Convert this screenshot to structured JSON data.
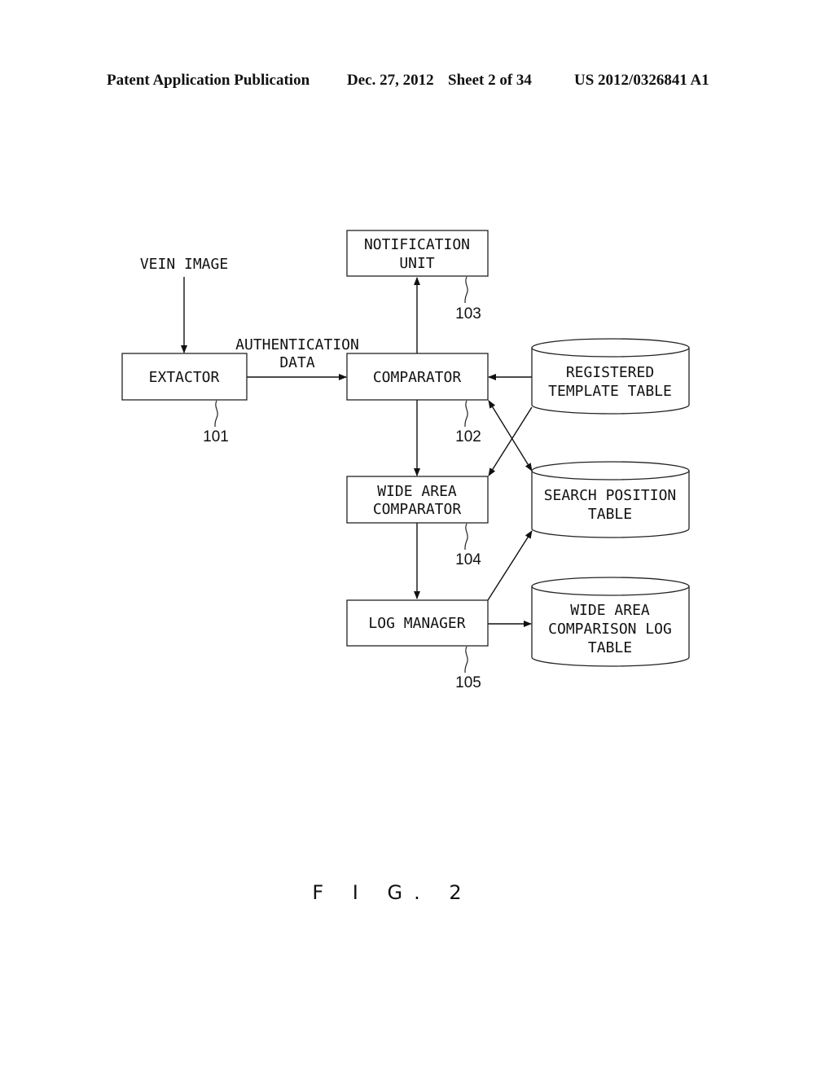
{
  "header": {
    "publication": "Patent Application Publication",
    "date": "Dec. 27, 2012",
    "sheet": "Sheet 2 of 34",
    "number": "US 2012/0326841 A1"
  },
  "diagram": {
    "input_label": "VEIN IMAGE",
    "edge_label": [
      "AUTHENTICATION",
      "DATA"
    ],
    "blocks": [
      {
        "id": "extactor",
        "lines": [
          "EXTACTOR"
        ],
        "ref": "101"
      },
      {
        "id": "comparator",
        "lines": [
          "COMPARATOR"
        ],
        "ref": "102"
      },
      {
        "id": "notification",
        "lines": [
          "NOTIFICATION",
          "UNIT"
        ],
        "ref": "103"
      },
      {
        "id": "wide-area-comparator",
        "lines": [
          "WIDE AREA",
          "COMPARATOR"
        ],
        "ref": "104"
      },
      {
        "id": "log-manager",
        "lines": [
          "LOG MANAGER"
        ],
        "ref": "105"
      }
    ],
    "databases": [
      {
        "id": "registered-template-table",
        "lines": [
          "REGISTERED",
          "TEMPLATE TABLE"
        ]
      },
      {
        "id": "search-position-table",
        "lines": [
          "SEARCH POSITION",
          "TABLE"
        ]
      },
      {
        "id": "wide-area-comparison-log-table",
        "lines": [
          "WIDE AREA",
          "COMPARISON LOG",
          "TABLE"
        ]
      }
    ],
    "edges": [
      {
        "from": "vein-image",
        "to": "extactor"
      },
      {
        "from": "extactor",
        "to": "comparator",
        "label": "AUTHENTICATION DATA"
      },
      {
        "from": "comparator",
        "to": "notification"
      },
      {
        "from": "registered-template-table",
        "to": "comparator"
      },
      {
        "from": "comparator",
        "to": "search-position-table",
        "bidirectional": true
      },
      {
        "from": "registered-template-table",
        "to": "wide-area-comparator"
      },
      {
        "from": "comparator",
        "to": "wide-area-comparator"
      },
      {
        "from": "wide-area-comparator",
        "to": "log-manager"
      },
      {
        "from": "log-manager",
        "to": "search-position-table"
      },
      {
        "from": "log-manager",
        "to": "wide-area-comparison-log-table"
      }
    ]
  },
  "figure_label": "F I G. 2"
}
